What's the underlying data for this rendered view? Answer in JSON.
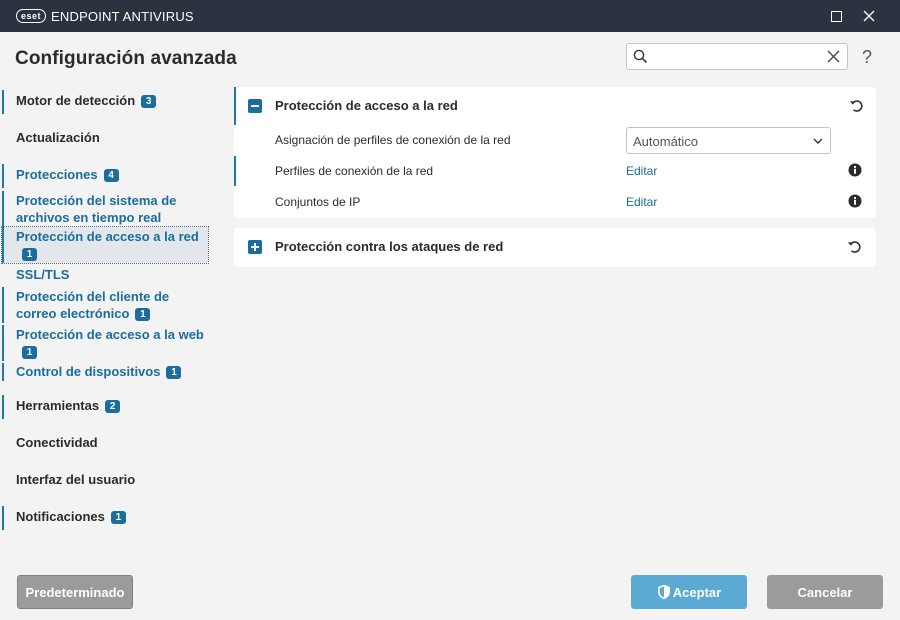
{
  "window": {
    "logo_text": "eset",
    "app_name": "ENDPOINT ANTIVIRUS"
  },
  "header": {
    "title": "Configuración avanzada",
    "search_value": "",
    "help_label": "?"
  },
  "sidebar": {
    "items": [
      {
        "label": "Motor de detección",
        "badge": "3"
      },
      {
        "label": "Actualización"
      },
      {
        "label": "Protecciones",
        "badge": "4"
      },
      {
        "label": "Protección del sistema de archivos en tiempo real"
      },
      {
        "label": "Protección de acceso a la red",
        "badge": "1"
      },
      {
        "label": "SSL/TLS"
      },
      {
        "label": "Protección del cliente de correo electrónico",
        "badge": "1"
      },
      {
        "label": "Protección de acceso a la web",
        "badge": "1"
      },
      {
        "label": "Control de dispositivos",
        "badge": "1"
      },
      {
        "label": "Herramientas",
        "badge": "2"
      },
      {
        "label": "Conectividad"
      },
      {
        "label": "Interfaz del usuario"
      },
      {
        "label": "Notificaciones",
        "badge": "1"
      }
    ]
  },
  "main": {
    "section1": {
      "title": "Protección de acceso a la red",
      "rows": [
        {
          "label": "Asignación de perfiles de conexión de la red",
          "value": "Automático"
        },
        {
          "label": "Perfiles de conexión de la red",
          "link": "Editar"
        },
        {
          "label": "Conjuntos de IP",
          "link": "Editar"
        }
      ]
    },
    "section2": {
      "title": "Protección contra los ataques de red"
    }
  },
  "footer": {
    "default_label": "Predeterminado",
    "accept_label": "Aceptar",
    "cancel_label": "Cancelar"
  },
  "colors": {
    "titlebar": "#2c3340",
    "accent": "#1a6d9c",
    "accept_button": "#5aaad3",
    "secondary_button": "#9b9b9e",
    "background": "#f3f3f4"
  }
}
